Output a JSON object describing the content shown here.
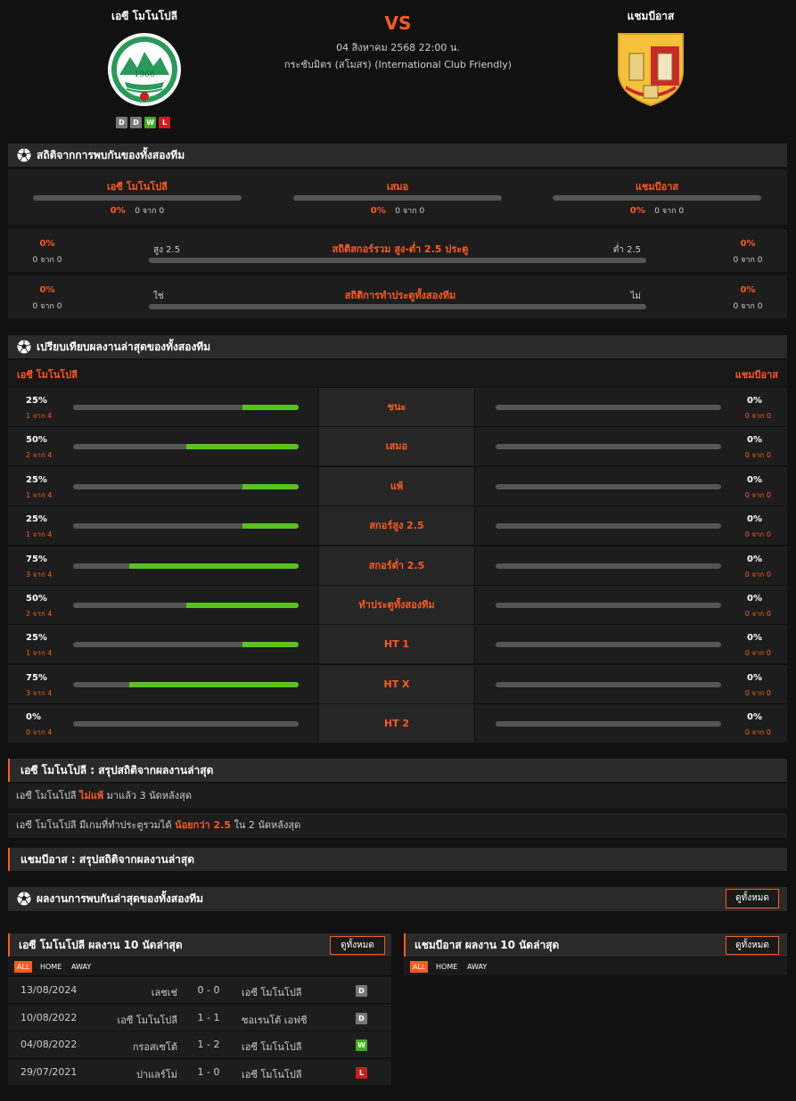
{
  "header": {
    "home_team": "เอซี โมโนโปลี",
    "away_team": "แชมบีอาส",
    "vs": "VS",
    "date": "04 สิงหาคม 2568 22:00 น.",
    "competition": "กระชับมิตร (สโมสร) (International Club Friendly)",
    "home_logo_text": "1966",
    "home_form": [
      "D",
      "D",
      "W",
      "L"
    ]
  },
  "h2h": {
    "title": "สถิติจากการพบกันของทั้งสองทีม",
    "cols": [
      {
        "label": "เอซี โมโนโปลี",
        "pct": "0%",
        "sub": "0 จาก 0",
        "value": 0
      },
      {
        "label": "เสมอ",
        "pct": "0%",
        "sub": "0 จาก 0",
        "value": 0
      },
      {
        "label": "แชมบีอาส",
        "pct": "0%",
        "sub": "0 จาก 0",
        "value": 0
      }
    ],
    "over_under": {
      "title": "สถิติสกอร์รวม สูง-ต่ำ 2.5 ประตู",
      "left_label": "สูง 2.5",
      "right_label": "ต่ำ 2.5",
      "left_pct": "0%",
      "left_sub": "0 จาก 0",
      "right_pct": "0%",
      "right_sub": "0 จาก 0"
    },
    "btts": {
      "title": "สถิติการทำประตูทั้งสองทีม",
      "left_label": "ใช่",
      "right_label": "ไม่",
      "left_pct": "0%",
      "left_sub": "0 จาก 0",
      "right_pct": "0%",
      "right_sub": "0 จาก 0"
    }
  },
  "compare": {
    "title": "เปรียบเทียบผลงานล่าสุดของทั้งสองทีม",
    "home": "เอซี โมโนโปลี",
    "away": "แชมบีอาส",
    "rows": [
      {
        "label": "ชนะ",
        "lp": "25%",
        "ls": "1 จาก 4",
        "lv": 0.25,
        "rp": "0%",
        "rs": "0 จาก 0",
        "rv": 0
      },
      {
        "label": "เสมอ",
        "lp": "50%",
        "ls": "2 จาก 4",
        "lv": 0.5,
        "rp": "0%",
        "rs": "0 จาก 0",
        "rv": 0
      },
      {
        "label": "แพ้",
        "lp": "25%",
        "ls": "1 จาก 4",
        "lv": 0.25,
        "rp": "0%",
        "rs": "0 จาก 0",
        "rv": 0
      },
      {
        "label": "สกอร์สูง 2.5",
        "lp": "25%",
        "ls": "1 จาก 4",
        "lv": 0.25,
        "rp": "0%",
        "rs": "0 จาก 0",
        "rv": 0
      },
      {
        "label": "สกอร์ต่ำ 2.5",
        "lp": "75%",
        "ls": "3 จาก 4",
        "lv": 0.75,
        "rp": "0%",
        "rs": "0 จาก 0",
        "rv": 0
      },
      {
        "label": "ทำประตูทั้งสองทีม",
        "lp": "50%",
        "ls": "2 จาก 4",
        "lv": 0.5,
        "rp": "0%",
        "rs": "0 จาก 0",
        "rv": 0
      },
      {
        "label": "HT 1",
        "lp": "25%",
        "ls": "1 จาก 4",
        "lv": 0.25,
        "rp": "0%",
        "rs": "0 จาก 0",
        "rv": 0
      },
      {
        "label": "HT X",
        "lp": "75%",
        "ls": "3 จาก 4",
        "lv": 0.75,
        "rp": "0%",
        "rs": "0 จาก 0",
        "rv": 0
      },
      {
        "label": "HT 2",
        "lp": "0%",
        "ls": "0 จาก 4",
        "lv": 0,
        "rp": "0%",
        "rs": "0 จาก 0",
        "rv": 0
      }
    ]
  },
  "summary": {
    "home_title": "เอซี โมโนโปลี : สรุปสถิติจากผลงานล่าสุด",
    "line1_a": "เอซี โมโนโปลี",
    "line1_b": "ไม่แพ้",
    "line1_c": "มาแล้ว 3 นัดหลังสุด",
    "line2_a": "เอซี โมโนโปลี มีเกมที่ทำประตูรวมได้",
    "line2_b": "น้อยกว่า  2.5",
    "line2_c": "ใน 2 นัดหลังสุด",
    "away_title": "แชมบีอาส : สรุปสถิติจากผลงานล่าสุด"
  },
  "recent_h2h": {
    "title": "ผลงานการพบกันล่าสุดของทั้งสองทีม",
    "view_all": "ดูทั้งหมด"
  },
  "last10": {
    "home_title": "เอซี โมโนโปลี ผลงาน 10 นัดล่าสุด",
    "away_title": "แชมบีอาส ผลงาน 10 นัดล่าสุด",
    "view_all": "ดูทั้งหมด",
    "tabs": [
      "ALL",
      "HOME",
      "AWAY"
    ],
    "matches": [
      {
        "date": "13/08/2024",
        "home": "เลชเช่",
        "score": "0 - 0",
        "away": "เอซี โมโนโปลี",
        "res": "D"
      },
      {
        "date": "10/08/2022",
        "home": "เอซี โมโนโปลี",
        "score": "1 - 1",
        "away": "ซอเรนโต้ เอฟซี",
        "res": "D"
      },
      {
        "date": "04/08/2022",
        "home": "กรอสเซโต้",
        "score": "1 - 2",
        "away": "เอซี โมโนโปลี",
        "res": "W"
      },
      {
        "date": "29/07/2021",
        "home": "ปาแลร์โม่",
        "score": "1 - 0",
        "away": "เอซี โมโนโปลี",
        "res": "L"
      }
    ]
  },
  "colors": {
    "accent": "#ff5a1f",
    "bar_fill": "#58c31c",
    "bar_bg": "#555555",
    "panel": "#1d1d1d"
  }
}
